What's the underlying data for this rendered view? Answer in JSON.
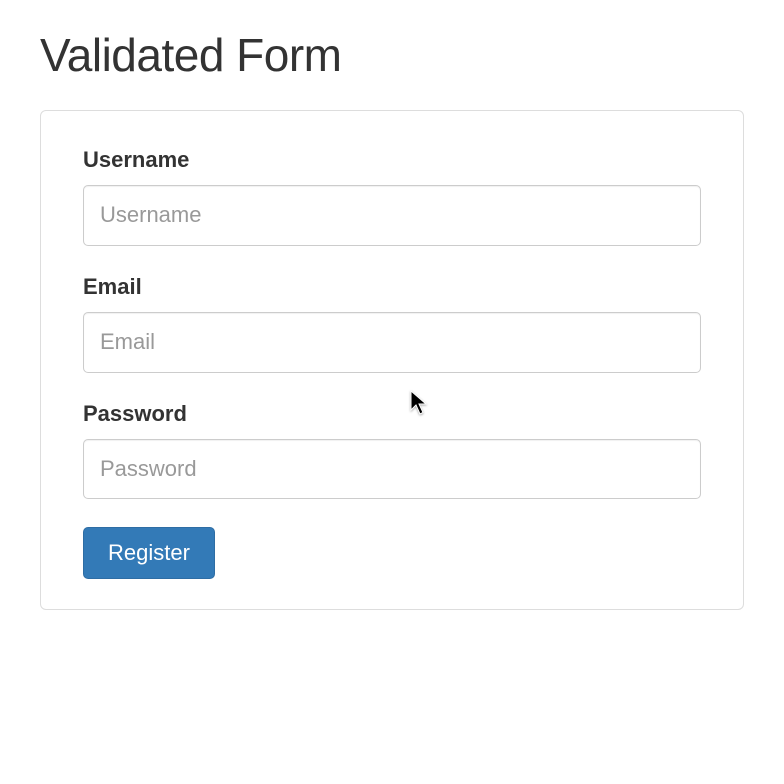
{
  "title": "Validated Form",
  "form": {
    "username": {
      "label": "Username",
      "placeholder": "Username",
      "value": ""
    },
    "email": {
      "label": "Email",
      "placeholder": "Email",
      "value": ""
    },
    "password": {
      "label": "Password",
      "placeholder": "Password",
      "value": ""
    },
    "submit_label": "Register"
  }
}
